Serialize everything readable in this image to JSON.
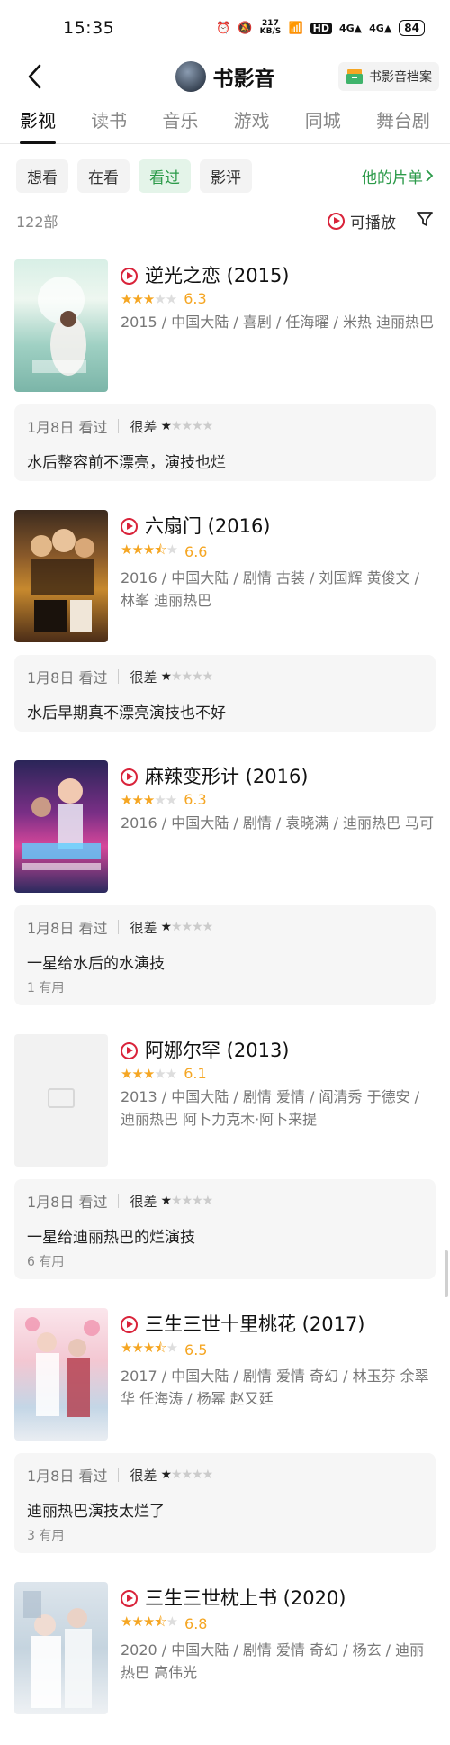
{
  "status": {
    "time": "15:35",
    "net_speed": "217 KB/S",
    "battery": "84"
  },
  "header": {
    "title": "书影音",
    "archive_label": "书影音档案"
  },
  "tabs": [
    {
      "label": "影视",
      "active": true
    },
    {
      "label": "读书"
    },
    {
      "label": "音乐"
    },
    {
      "label": "游戏"
    },
    {
      "label": "同城"
    },
    {
      "label": "舞台剧"
    }
  ],
  "filters": [
    {
      "label": "想看"
    },
    {
      "label": "在看"
    },
    {
      "label": "看过",
      "active": true
    },
    {
      "label": "影评"
    }
  ],
  "my_list_label": "他的片单",
  "count_label": "122部",
  "playable_label": "可播放",
  "colors": {
    "accent_green": "#2b9a49",
    "play_red": "#d9233a",
    "star_orange": "#f5a623"
  },
  "items": [
    {
      "title": "逆光之恋 (2015)",
      "stars": 3,
      "score": "6.3",
      "meta": "2015 / 中国大陆 / 喜剧 / 任海曜 / 米热 迪丽热巴",
      "review": {
        "date": "1月8日 看过",
        "level": "很差",
        "user_stars": 1,
        "text": "水后整容前不漂亮，演技也烂",
        "useful": ""
      }
    },
    {
      "title": "六扇门 (2016)",
      "stars": 3.5,
      "score": "6.6",
      "meta": "2016 / 中国大陆 / 剧情 古装 / 刘国辉 黄俊文 / 林峯 迪丽热巴",
      "review": {
        "date": "1月8日 看过",
        "level": "很差",
        "user_stars": 1,
        "text": "水后早期真不漂亮演技也不好",
        "useful": ""
      }
    },
    {
      "title": "麻辣变形计 (2016)",
      "stars": 3,
      "score": "6.3",
      "meta": "2016 / 中国大陆 / 剧情 / 袁晓满 / 迪丽热巴 马可",
      "review": {
        "date": "1月8日 看过",
        "level": "很差",
        "user_stars": 1,
        "text": "一星给水后的水演技",
        "useful": "1 有用"
      }
    },
    {
      "title": "阿娜尔罕 (2013)",
      "stars": 3,
      "score": "6.1",
      "meta": "2013 / 中国大陆 / 剧情 爱情 / 阎清秀 于德安 / 迪丽热巴 阿卜力克木·阿卜来提",
      "review": {
        "date": "1月8日 看过",
        "level": "很差",
        "user_stars": 1,
        "text": "一星给迪丽热巴的烂演技",
        "useful": "6 有用"
      }
    },
    {
      "title": "三生三世十里桃花 (2017)",
      "stars": 3.5,
      "score": "6.5",
      "meta": "2017 / 中国大陆 / 剧情 爱情 奇幻 / 林玉芬 余翠华 任海涛 / 杨幂 赵又廷",
      "review": {
        "date": "1月8日 看过",
        "level": "很差",
        "user_stars": 1,
        "text": "迪丽热巴演技太烂了",
        "useful": "3 有用"
      }
    },
    {
      "title": "三生三世枕上书 (2020)",
      "stars": 3.5,
      "score": "6.8",
      "meta": "2020 / 中国大陆 / 剧情 爱情 奇幻 / 杨玄 / 迪丽热巴 高伟光",
      "review": null
    }
  ]
}
